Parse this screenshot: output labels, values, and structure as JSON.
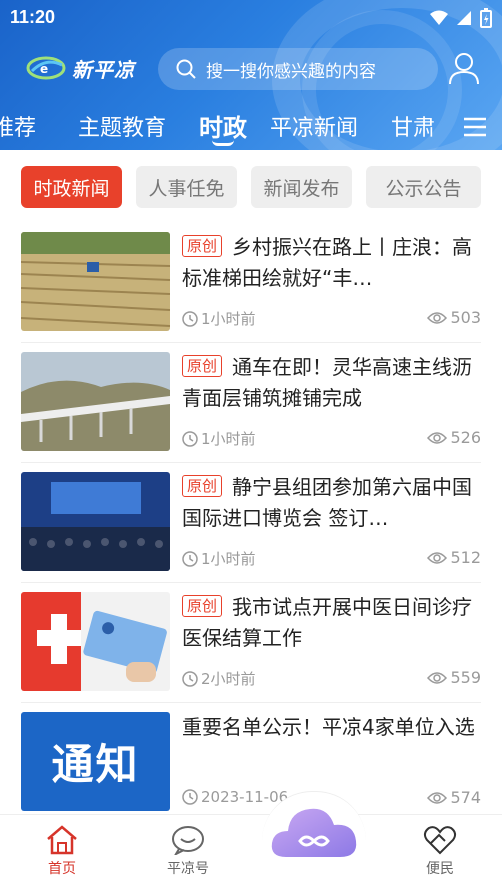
{
  "status_bar": {
    "time": "11:20"
  },
  "header": {
    "logo_text": "新平凉",
    "search_placeholder": "搜一搜你感兴趣的内容"
  },
  "tabs": [
    {
      "label": "推荐"
    },
    {
      "label": "主题教育"
    },
    {
      "label": "时政"
    },
    {
      "label": "平凉新闻"
    },
    {
      "label": "甘肃"
    }
  ],
  "sub_tabs": [
    {
      "label": "时政新闻"
    },
    {
      "label": "人事任免"
    },
    {
      "label": "新闻发布"
    },
    {
      "label": "公示公告"
    }
  ],
  "articles": [
    {
      "badge": "原创",
      "title": "乡村振兴在路上丨庄浪：高标准梯田绘就好“丰…",
      "time": "1小时前",
      "views": "503",
      "thumb": "cornfield"
    },
    {
      "badge": "原创",
      "title": "通车在即！灵华高速主线沥青面层铺筑摊铺完成",
      "time": "1小时前",
      "views": "526",
      "thumb": "highway"
    },
    {
      "badge": "原创",
      "title": "静宁县组团参加第六届中国国际进口博览会 签订…",
      "time": "1小时前",
      "views": "512",
      "thumb": "conference"
    },
    {
      "badge": "原创",
      "title": "我市试点开展中医日间诊疗医保结算工作",
      "time": "2小时前",
      "views": "559",
      "thumb": "medical-card"
    },
    {
      "badge": "",
      "title": "重要名单公示！平凉4家单位入选",
      "time": "2023-11-06",
      "views": "574",
      "thumb": "notice",
      "thumb_text": "通知"
    }
  ],
  "bottom_nav": [
    {
      "label": "首页",
      "icon": "home-icon"
    },
    {
      "label": "平凉号",
      "icon": "chat-icon"
    },
    {
      "label": "",
      "icon": "cloud-icon"
    },
    {
      "label": "便民",
      "icon": "heart-hands-icon"
    }
  ],
  "colors": {
    "header": "#2a7fe0",
    "accent": "#e8412b",
    "nav_active": "#d6342a"
  }
}
